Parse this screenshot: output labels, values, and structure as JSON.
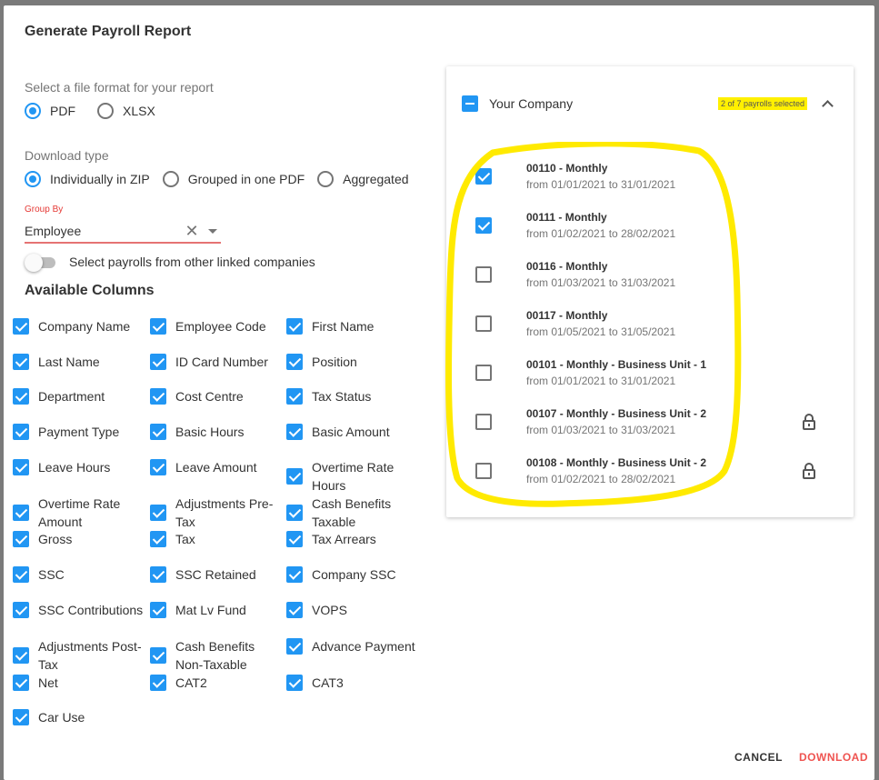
{
  "dialog": {
    "title": "Generate Payroll Report"
  },
  "file_format": {
    "label": "Select a file format for your report",
    "options": [
      {
        "label": "PDF",
        "selected": true
      },
      {
        "label": "XLSX",
        "selected": false
      }
    ]
  },
  "download_type": {
    "label": "Download type",
    "options": [
      {
        "label": "Individually in ZIP",
        "selected": true
      },
      {
        "label": "Grouped in one PDF",
        "selected": false
      },
      {
        "label": "Aggregated",
        "selected": false
      }
    ]
  },
  "group_by": {
    "label": "Group By",
    "value": "Employee",
    "clear_glyph": "✕"
  },
  "linked_toggle": {
    "label": "Select payrolls from other linked companies",
    "on": false
  },
  "available_columns": {
    "title": "Available Columns",
    "items": [
      {
        "label": "Company Name",
        "checked": true
      },
      {
        "label": "Employee Code",
        "checked": true
      },
      {
        "label": "First Name",
        "checked": true
      },
      {
        "label": "Last Name",
        "checked": true
      },
      {
        "label": "ID Card Number",
        "checked": true
      },
      {
        "label": "Position",
        "checked": true
      },
      {
        "label": "Department",
        "checked": true
      },
      {
        "label": "Cost Centre",
        "checked": true
      },
      {
        "label": "Tax Status",
        "checked": true
      },
      {
        "label": "Payment Type",
        "checked": true
      },
      {
        "label": "Basic Hours",
        "checked": true
      },
      {
        "label": "Basic Amount",
        "checked": true
      },
      {
        "label": "Leave Hours",
        "checked": true
      },
      {
        "label": "Leave Amount",
        "checked": true
      },
      {
        "label": "Overtime Rate Hours",
        "checked": true
      },
      {
        "label": "Overtime Rate Amount",
        "checked": true
      },
      {
        "label": "Adjustments Pre-Tax",
        "checked": true
      },
      {
        "label": "Cash Benefits Taxable",
        "checked": true
      },
      {
        "label": "Gross",
        "checked": true
      },
      {
        "label": "Tax",
        "checked": true
      },
      {
        "label": "Tax Arrears",
        "checked": true
      },
      {
        "label": "SSC",
        "checked": true
      },
      {
        "label": "SSC Retained",
        "checked": true
      },
      {
        "label": "Company SSC",
        "checked": true
      },
      {
        "label": "SSC Contributions",
        "checked": true
      },
      {
        "label": "Mat Lv Fund",
        "checked": true
      },
      {
        "label": "VOPS",
        "checked": true
      },
      {
        "label": "Adjustments Post-Tax",
        "checked": true
      },
      {
        "label": "Cash Benefits Non-Taxable",
        "checked": true
      },
      {
        "label": "Advance Payment",
        "checked": true
      },
      {
        "label": "Net",
        "checked": true
      },
      {
        "label": "CAT2",
        "checked": true
      },
      {
        "label": "CAT3",
        "checked": true
      },
      {
        "label": "Car Use",
        "checked": true
      }
    ]
  },
  "company_panel": {
    "company_name": "Your Company",
    "selected_summary": "2 of 7 payrolls selected",
    "highlight_color": "#fff000",
    "payrolls": [
      {
        "name": "00110 - Monthly",
        "range": "from 01/01/2021 to 31/01/2021",
        "checked": true,
        "locked": false
      },
      {
        "name": "00111 - Monthly",
        "range": "from 01/02/2021 to 28/02/2021",
        "checked": true,
        "locked": false
      },
      {
        "name": "00116 - Monthly",
        "range": "from 01/03/2021 to 31/03/2021",
        "checked": false,
        "locked": false
      },
      {
        "name": "00117 - Monthly",
        "range": "from 01/05/2021 to 31/05/2021",
        "checked": false,
        "locked": false
      },
      {
        "name": "00101 - Monthly - Business Unit - 1",
        "range": "from 01/01/2021 to 31/01/2021",
        "checked": false,
        "locked": false
      },
      {
        "name": "00107 - Monthly - Business Unit - 2",
        "range": "from 01/03/2021 to 31/03/2021",
        "checked": false,
        "locked": true
      },
      {
        "name": "00108 - Monthly - Business Unit - 2",
        "range": "from 01/02/2021 to 28/02/2021",
        "checked": false,
        "locked": true
      }
    ]
  },
  "actions": {
    "cancel": "CANCEL",
    "download": "DOWNLOAD"
  },
  "colors": {
    "accent": "#2196f3",
    "error": "#e53935",
    "download": "#ef5350"
  }
}
